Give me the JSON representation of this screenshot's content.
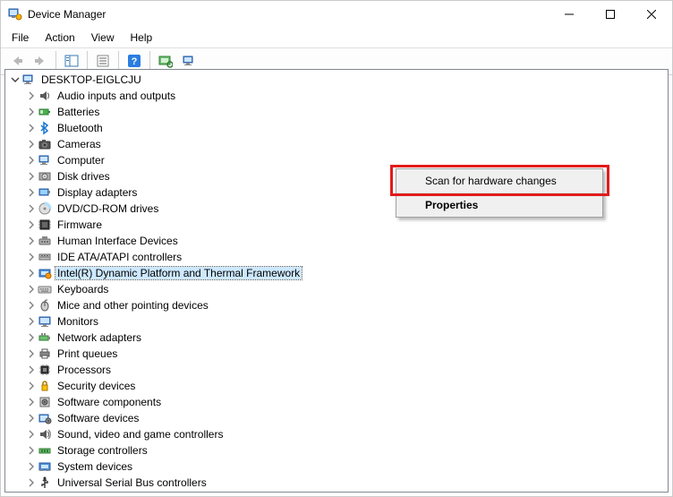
{
  "window": {
    "title": "Device Manager"
  },
  "menu": {
    "file": "File",
    "action": "Action",
    "view": "View",
    "help": "Help"
  },
  "toolbar_icons": {
    "back": "back-arrow-icon",
    "forward": "forward-arrow-icon",
    "show_hide": "show-hide-console-tree-icon",
    "properties": "properties-icon",
    "help": "help-icon",
    "scan": "scan-hardware-icon",
    "uninstall": "uninstall-icon"
  },
  "tree": {
    "root": {
      "label": "DESKTOP-EIGLCJU",
      "expanded": true,
      "icon": "computer-icon"
    },
    "children": [
      {
        "label": "Audio inputs and outputs",
        "icon": "audio-icon"
      },
      {
        "label": "Batteries",
        "icon": "battery-icon"
      },
      {
        "label": "Bluetooth",
        "icon": "bluetooth-icon"
      },
      {
        "label": "Cameras",
        "icon": "camera-icon"
      },
      {
        "label": "Computer",
        "icon": "computer-icon"
      },
      {
        "label": "Disk drives",
        "icon": "disk-drive-icon"
      },
      {
        "label": "Display adapters",
        "icon": "display-adapter-icon"
      },
      {
        "label": "DVD/CD-ROM drives",
        "icon": "optical-drive-icon"
      },
      {
        "label": "Firmware",
        "icon": "firmware-icon"
      },
      {
        "label": "Human Interface Devices",
        "icon": "hid-icon"
      },
      {
        "label": "IDE ATA/ATAPI controllers",
        "icon": "ide-icon"
      },
      {
        "label": "Intel(R) Dynamic Platform and Thermal Framework",
        "icon": "intel-thermal-icon",
        "selected": true
      },
      {
        "label": "Keyboards",
        "icon": "keyboard-icon"
      },
      {
        "label": "Mice and other pointing devices",
        "icon": "mouse-icon"
      },
      {
        "label": "Monitors",
        "icon": "monitor-icon"
      },
      {
        "label": "Network adapters",
        "icon": "network-adapter-icon"
      },
      {
        "label": "Print queues",
        "icon": "printer-icon"
      },
      {
        "label": "Processors",
        "icon": "processor-icon"
      },
      {
        "label": "Security devices",
        "icon": "security-device-icon"
      },
      {
        "label": "Software components",
        "icon": "software-component-icon"
      },
      {
        "label": "Software devices",
        "icon": "software-device-icon"
      },
      {
        "label": "Sound, video and game controllers",
        "icon": "sound-video-icon"
      },
      {
        "label": "Storage controllers",
        "icon": "storage-controller-icon"
      },
      {
        "label": "System devices",
        "icon": "system-device-icon"
      },
      {
        "label": "Universal Serial Bus controllers",
        "icon": "usb-icon"
      }
    ]
  },
  "context_menu": {
    "items": [
      {
        "label": "Scan for hardware changes",
        "default": false
      },
      {
        "label": "Properties",
        "default": true
      }
    ]
  }
}
